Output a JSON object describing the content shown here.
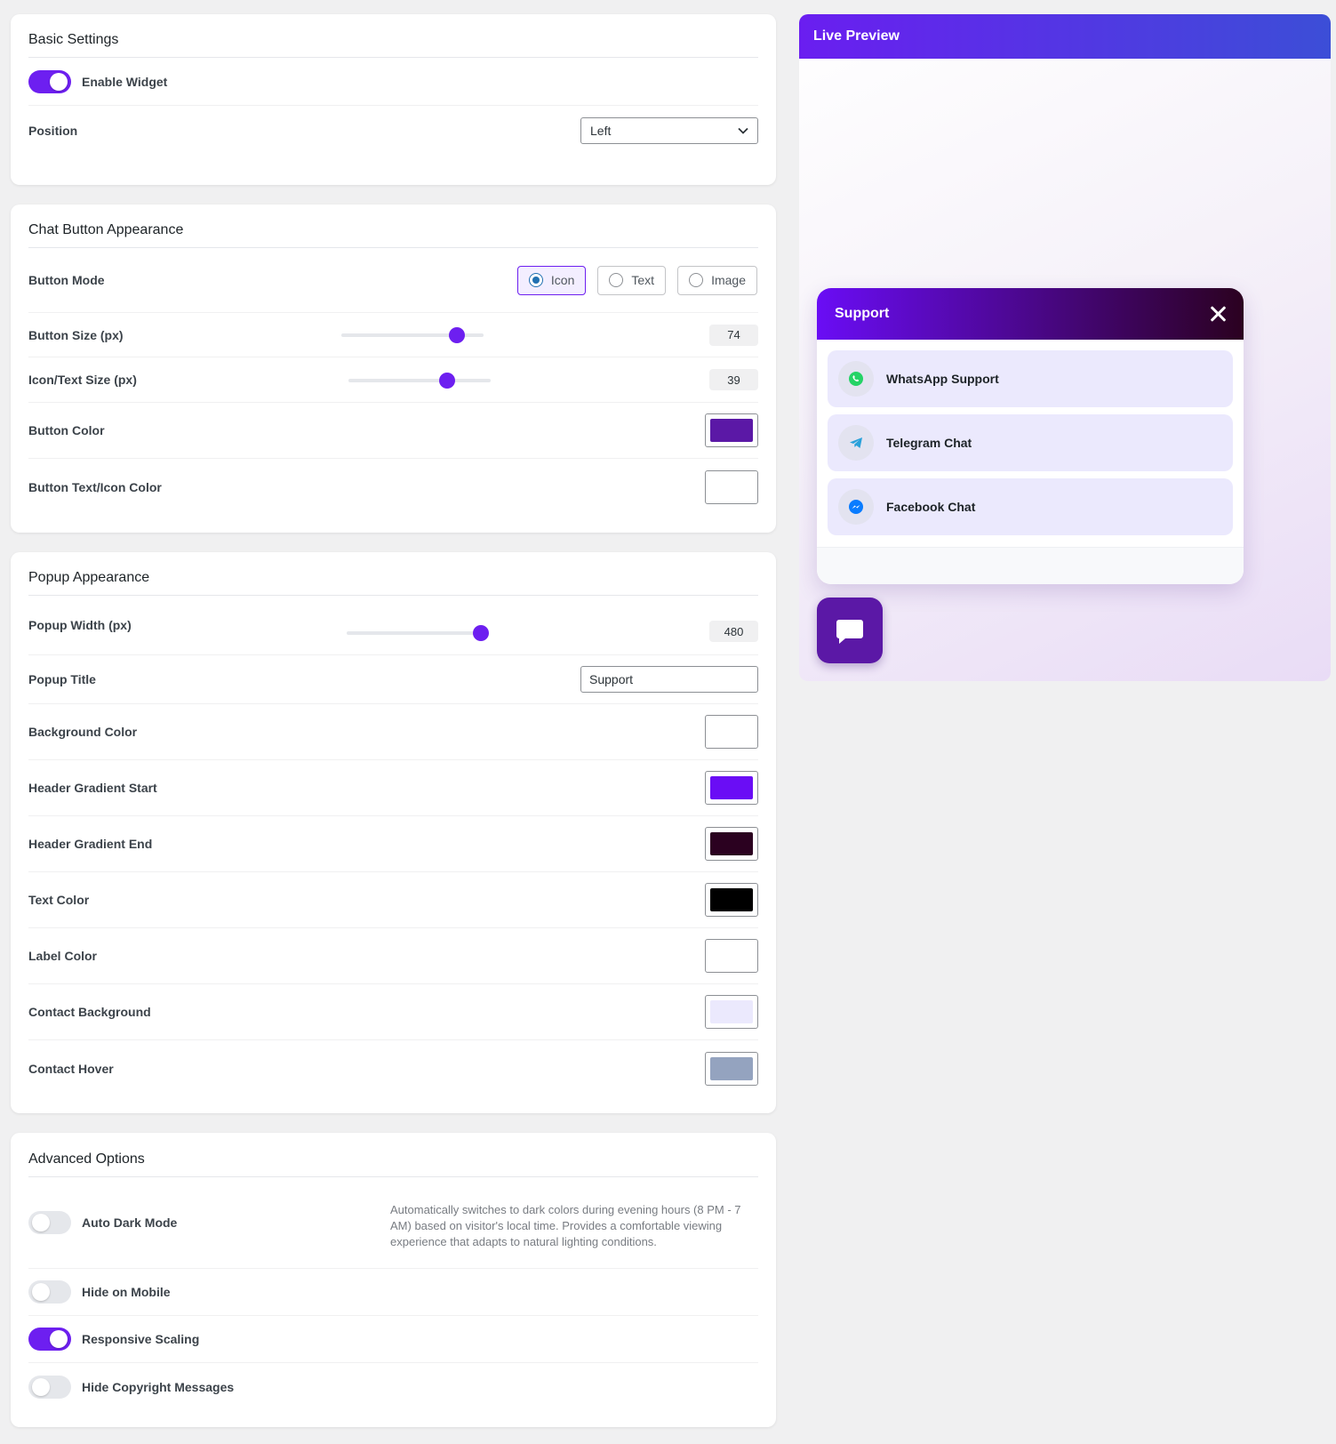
{
  "basic": {
    "title": "Basic Settings",
    "enable_widget_label": "Enable Widget",
    "enable_widget_on": true,
    "position_label": "Position",
    "position_value": "Left"
  },
  "chat_button": {
    "title": "Chat Button Appearance",
    "mode_label": "Button Mode",
    "modes": [
      "Icon",
      "Text",
      "Image"
    ],
    "selected_mode": "Icon",
    "size_label": "Button Size (px)",
    "size_value": "74",
    "icon_size_label": "Icon/Text Size (px)",
    "icon_size_value": "39",
    "color_label": "Button Color",
    "color_value": "#5b18a6",
    "text_color_label": "Button Text/Icon Color",
    "text_color_value": "#ffffff"
  },
  "popup": {
    "title": "Popup Appearance",
    "width_label": "Popup Width (px)",
    "width_value": "480",
    "popup_title_label": "Popup Title",
    "popup_title_value": "Support",
    "bg_color_label": "Background Color",
    "bg_color_value": "#ffffff",
    "grad_start_label": "Header Gradient Start",
    "grad_start_value": "#6a0df5",
    "grad_end_label": "Header Gradient End",
    "grad_end_value": "#2b0120",
    "text_color_label": "Text Color",
    "text_color_value": "#000000",
    "label_color_label": "Label Color",
    "label_color_value": "#ffffff",
    "contact_bg_label": "Contact Background",
    "contact_bg_value": "#ebe9fd",
    "contact_hover_label": "Contact Hover",
    "contact_hover_value": "#94a3bf"
  },
  "advanced": {
    "title": "Advanced Options",
    "auto_dark_label": "Auto Dark Mode",
    "auto_dark_on": false,
    "auto_dark_help": "Automatically switches to dark colors during evening hours (8 PM - 7 AM) based on visitor's local time. Provides a comfortable viewing experience that adapts to natural lighting conditions.",
    "hide_mobile_label": "Hide on Mobile",
    "hide_mobile_on": false,
    "responsive_label": "Responsive Scaling",
    "responsive_on": true,
    "hide_copyright_label": "Hide Copyright Messages",
    "hide_copyright_on": false
  },
  "preview": {
    "title": "Live Preview",
    "popup_title": "Support",
    "contacts": [
      {
        "label": "WhatsApp Support",
        "icon": "whatsapp-icon",
        "color": "#25d366"
      },
      {
        "label": "Telegram Chat",
        "icon": "telegram-icon",
        "color": "#2aa1da"
      },
      {
        "label": "Facebook Chat",
        "icon": "messenger-icon",
        "color": "#0a7cff"
      }
    ]
  }
}
